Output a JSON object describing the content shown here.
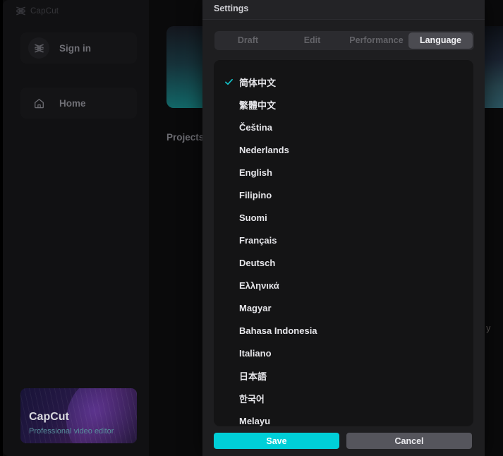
{
  "app": {
    "brand_name": "CapCut",
    "brand_icon": "capcut-logo-icon",
    "sidebar": {
      "sign_in_label": "Sign in",
      "sign_in_icon": "capcut-avatar-icon",
      "home_label": "Home",
      "home_icon": "home-icon",
      "promo": {
        "title": "CapCut",
        "subtitle": "Professional video editor"
      }
    },
    "main": {
      "projects_label": "Projects",
      "right_partial_text": "ing y"
    }
  },
  "dialog": {
    "title": "Settings",
    "tabs": [
      {
        "label": "Draft",
        "active": false
      },
      {
        "label": "Edit",
        "active": false
      },
      {
        "label": "Performance",
        "active": false
      },
      {
        "label": "Language",
        "active": true
      }
    ],
    "languages": [
      {
        "label": "简体中文",
        "selected": true
      },
      {
        "label": "繁體中文",
        "selected": false
      },
      {
        "label": "Čeština",
        "selected": false
      },
      {
        "label": "Nederlands",
        "selected": false
      },
      {
        "label": "English",
        "selected": false
      },
      {
        "label": "Filipino",
        "selected": false
      },
      {
        "label": "Suomi",
        "selected": false
      },
      {
        "label": "Français",
        "selected": false
      },
      {
        "label": "Deutsch",
        "selected": false
      },
      {
        "label": "Ελληνικά",
        "selected": false
      },
      {
        "label": "Magyar",
        "selected": false
      },
      {
        "label": "Bahasa Indonesia",
        "selected": false
      },
      {
        "label": "Italiano",
        "selected": false
      },
      {
        "label": "日本語",
        "selected": false
      },
      {
        "label": "한국어",
        "selected": false
      },
      {
        "label": "Melayu",
        "selected": false
      }
    ],
    "footer": {
      "save_label": "Save",
      "cancel_label": "Cancel"
    }
  },
  "colors": {
    "accent_cyan": "#00CFD8",
    "check_teal": "#13C8CE",
    "cancel_gray": "#55555C",
    "active_tab_bg": "#4B4B51",
    "dialog_bg": "#1E1E20",
    "list_bg": "#141415"
  }
}
